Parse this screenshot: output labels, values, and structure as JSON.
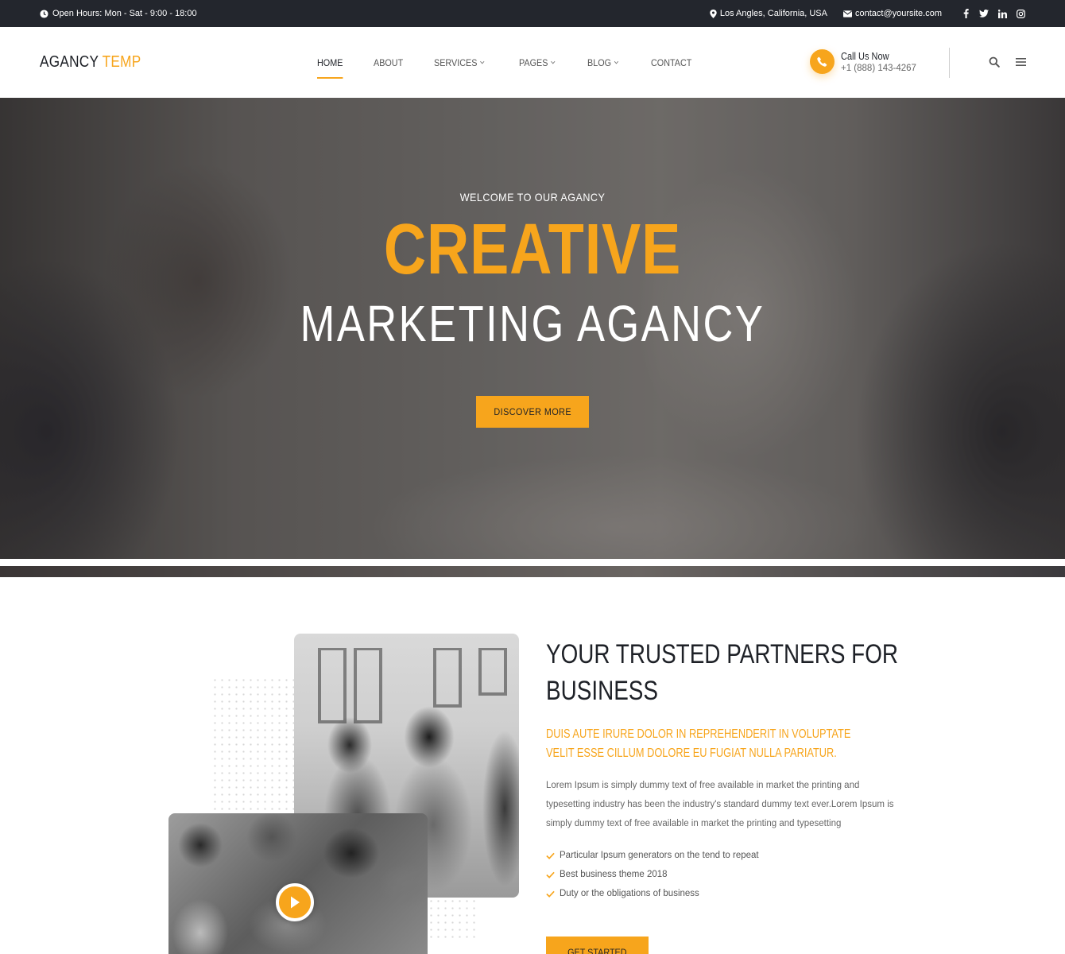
{
  "topbar": {
    "hours": "Open Hours: Mon - Sat - 9:00 - 18:00",
    "location": "Los Angles, California, USA",
    "email": "contact@yoursite.com",
    "socials": [
      "facebook-icon",
      "twitter-icon",
      "linkedin-icon",
      "instagram-icon"
    ]
  },
  "header": {
    "logo_part1": "AGANCY",
    "logo_part2": "TEMP",
    "nav": [
      {
        "label": "HOME",
        "active": true
      },
      {
        "label": "ABOUT"
      },
      {
        "label": "SERVICES",
        "dropdown": true
      },
      {
        "label": "PAGES",
        "dropdown": true
      },
      {
        "label": "BLOG",
        "dropdown": true
      },
      {
        "label": "CONTACT"
      }
    ],
    "call_label": "Call Us Now",
    "call_number": "+1 (888) 143-4267"
  },
  "hero": {
    "welcome": "WELCOME TO OUR AGANCY",
    "title1": "CREATIVE",
    "title2": "MARKETING AGANCY",
    "button": "DISCOVER MORE"
  },
  "about": {
    "title": "YOUR TRUSTED PARTNERS FOR BUSINESS",
    "subtitle": "DUIS AUTE IRURE DOLOR IN REPREHENDERIT IN VOLUPTATE VELIT ESSE CILLUM DOLORE EU FUGIAT NULLA PARIATUR.",
    "text": "Lorem Ipsum is simply dummy text of free available in market the printing and typesetting industry has been the industry's standard dummy text ever.Lorem Ipsum is simply dummy text of free available in market the printing and typesetting",
    "checks": [
      "Particular Ipsum generators on the tend to repeat",
      "Best business theme 2018",
      "Duty or the obligations of business"
    ],
    "button": "GET STARTED"
  },
  "colors": {
    "accent": "#f7a51c",
    "topbar_bg": "#23262d",
    "heading": "#1e2127"
  }
}
